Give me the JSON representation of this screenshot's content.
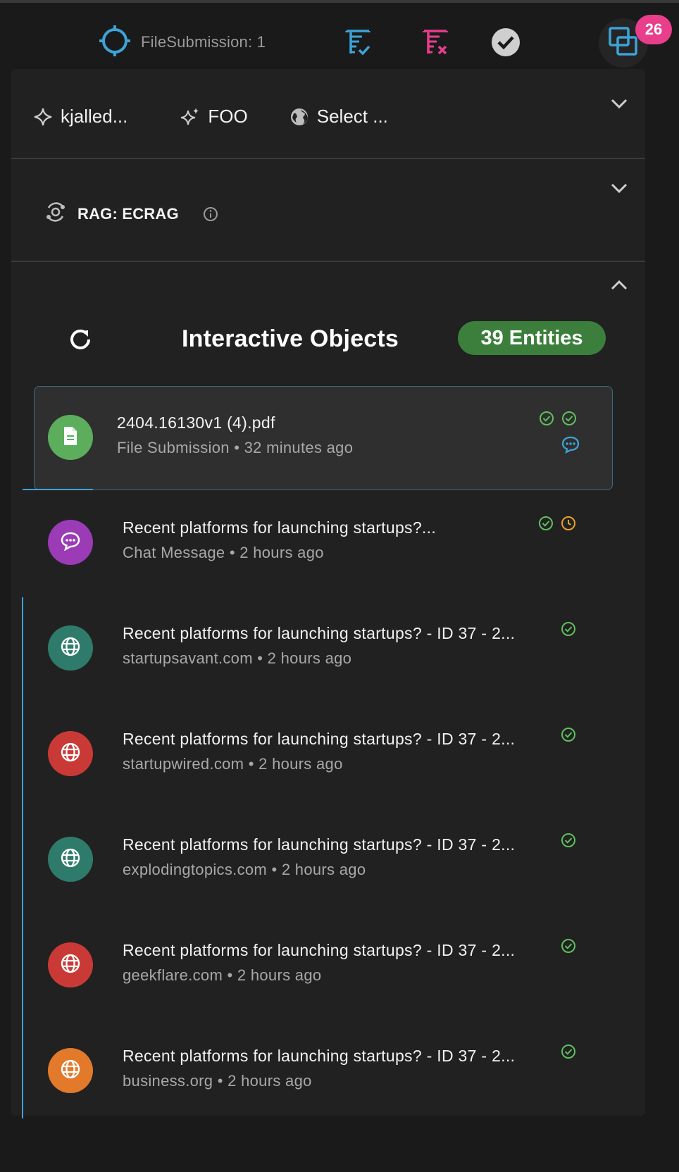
{
  "toolbar": {
    "file_submission_label": "FileSubmission: 1",
    "badge_count": "26",
    "accent_color": "#3da3d8",
    "reject_color": "#e83e8c"
  },
  "selectors": {
    "user_chip": "kjalled...",
    "model_chip": "FOO",
    "source_chip": "Select ..."
  },
  "rag": {
    "label": "RAG: ECRAG"
  },
  "interactive_objects": {
    "title": "Interactive Objects",
    "entities_label": "39 Entities",
    "items": [
      {
        "title": "2404.16130v1 (4).pdf",
        "subtitle": "File Submission • 32 minutes ago",
        "avatar_color": "#5cae5c",
        "icon": "file-icon",
        "selected": true
      },
      {
        "title": "Recent platforms for launching startups?...",
        "subtitle": "Chat Message • 2 hours ago",
        "avatar_color": "#9b3bb5",
        "icon": "chat-icon"
      },
      {
        "title": "Recent platforms for launching startups? - ID 37 - 2...",
        "subtitle": "startupsavant.com • 2 hours ago",
        "avatar_color": "#2f7b6b",
        "icon": "globe-icon"
      },
      {
        "title": "Recent platforms for launching startups? - ID 37 - 2...",
        "subtitle": "startupwired.com • 2 hours ago",
        "avatar_color": "#c93a36",
        "icon": "globe-icon"
      },
      {
        "title": "Recent platforms for launching startups? - ID 37 - 2...",
        "subtitle": "explodingtopics.com • 2 hours ago",
        "avatar_color": "#2f7b6b",
        "icon": "globe-icon"
      },
      {
        "title": "Recent platforms for launching startups? - ID 37 - 2...",
        "subtitle": "geekflare.com • 2 hours ago",
        "avatar_color": "#c93a36",
        "icon": "globe-icon"
      },
      {
        "title": "Recent platforms for launching startups? - ID 37 - 2...",
        "subtitle": "business.org • 2 hours ago",
        "avatar_color": "#e37a2b",
        "icon": "globe-icon"
      }
    ]
  }
}
